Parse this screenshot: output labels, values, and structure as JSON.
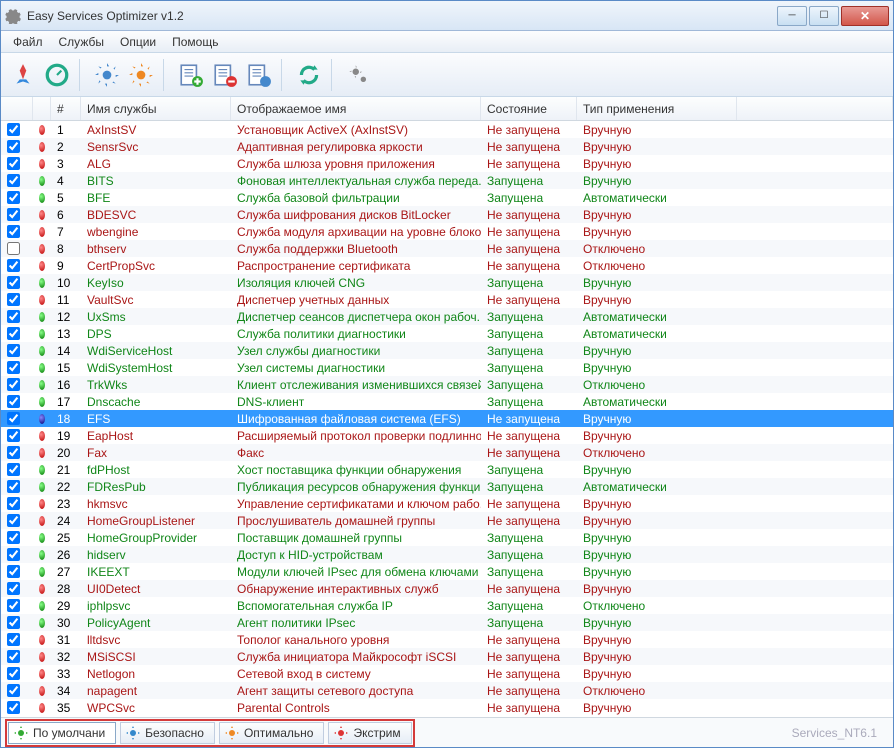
{
  "title": "Easy Services Optimizer v1.2",
  "menu": [
    "Файл",
    "Службы",
    "Опции",
    "Помощь"
  ],
  "columns": {
    "num": "#",
    "name": "Имя службы",
    "disp": "Отображаемое имя",
    "state": "Состояние",
    "type": "Тип применения"
  },
  "footer": {
    "tabs": [
      "По умолчани",
      "Безопасно",
      "Оптимально",
      "Экстрим"
    ],
    "status": "Services_NT6.1"
  },
  "rows": [
    {
      "n": 1,
      "chk": true,
      "dot": "red",
      "name": "AxInstSV",
      "disp": "Установщик ActiveX (AxInstSV)",
      "state": "Не запущена",
      "type": "Вручную",
      "c": "red"
    },
    {
      "n": 2,
      "chk": true,
      "dot": "red",
      "name": "SensrSvc",
      "disp": "Адаптивная регулировка яркости",
      "state": "Не запущена",
      "type": "Вручную",
      "c": "red"
    },
    {
      "n": 3,
      "chk": true,
      "dot": "red",
      "name": "ALG",
      "disp": "Служба шлюза уровня приложения",
      "state": "Не запущена",
      "type": "Вручную",
      "c": "red"
    },
    {
      "n": 4,
      "chk": true,
      "dot": "green",
      "name": "BITS",
      "disp": "Фоновая интеллектуальная служба переда...",
      "state": "Запущена",
      "type": "Вручную",
      "c": "green"
    },
    {
      "n": 5,
      "chk": true,
      "dot": "green",
      "name": "BFE",
      "disp": "Служба базовой фильтрации",
      "state": "Запущена",
      "type": "Автоматически",
      "c": "green"
    },
    {
      "n": 6,
      "chk": true,
      "dot": "red",
      "name": "BDESVC",
      "disp": "Служба шифрования дисков BitLocker",
      "state": "Не запущена",
      "type": "Вручную",
      "c": "red"
    },
    {
      "n": 7,
      "chk": true,
      "dot": "red",
      "name": "wbengine",
      "disp": "Служба модуля архивации на уровне блоков",
      "state": "Не запущена",
      "type": "Вручную",
      "c": "red"
    },
    {
      "n": 8,
      "chk": false,
      "dot": "red",
      "name": "bthserv",
      "disp": "Служба поддержки Bluetooth",
      "state": "Не запущена",
      "type": "Отключено",
      "c": "red"
    },
    {
      "n": 9,
      "chk": true,
      "dot": "red",
      "name": "CertPropSvc",
      "disp": "Распространение сертификата",
      "state": "Не запущена",
      "type": "Отключено",
      "c": "red"
    },
    {
      "n": 10,
      "chk": true,
      "dot": "green",
      "name": "KeyIso",
      "disp": "Изоляция ключей CNG",
      "state": "Запущена",
      "type": "Вручную",
      "c": "green"
    },
    {
      "n": 11,
      "chk": true,
      "dot": "red",
      "name": "VaultSvc",
      "disp": "Диспетчер учетных данных",
      "state": "Не запущена",
      "type": "Вручную",
      "c": "red"
    },
    {
      "n": 12,
      "chk": true,
      "dot": "green",
      "name": "UxSms",
      "disp": "Диспетчер сеансов диспетчера окон рабоч...",
      "state": "Запущена",
      "type": "Автоматически",
      "c": "green"
    },
    {
      "n": 13,
      "chk": true,
      "dot": "green",
      "name": "DPS",
      "disp": "Служба политики диагностики",
      "state": "Запущена",
      "type": "Автоматически",
      "c": "green"
    },
    {
      "n": 14,
      "chk": true,
      "dot": "green",
      "name": "WdiServiceHost",
      "disp": "Узел службы диагностики",
      "state": "Запущена",
      "type": "Вручную",
      "c": "green"
    },
    {
      "n": 15,
      "chk": true,
      "dot": "green",
      "name": "WdiSystemHost",
      "disp": "Узел системы диагностики",
      "state": "Запущена",
      "type": "Вручную",
      "c": "green"
    },
    {
      "n": 16,
      "chk": true,
      "dot": "green",
      "name": "TrkWks",
      "disp": "Клиент отслеживания изменившихся связей",
      "state": "Запущена",
      "type": "Отключено",
      "c": "green"
    },
    {
      "n": 17,
      "chk": true,
      "dot": "green",
      "name": "Dnscache",
      "disp": "DNS-клиент",
      "state": "Запущена",
      "type": "Автоматически",
      "c": "green"
    },
    {
      "n": 18,
      "chk": true,
      "dot": "blue",
      "name": "EFS",
      "disp": "Шифрованная файловая система (EFS)",
      "state": "Не запущена",
      "type": "Вручную",
      "c": "blue",
      "sel": true
    },
    {
      "n": 19,
      "chk": true,
      "dot": "red",
      "name": "EapHost",
      "disp": "Расширяемый протокол проверки подлинно...",
      "state": "Не запущена",
      "type": "Вручную",
      "c": "red"
    },
    {
      "n": 20,
      "chk": true,
      "dot": "red",
      "name": "Fax",
      "disp": "Факс",
      "state": "Не запущена",
      "type": "Отключено",
      "c": "red"
    },
    {
      "n": 21,
      "chk": true,
      "dot": "green",
      "name": "fdPHost",
      "disp": "Хост поставщика функции обнаружения",
      "state": "Запущена",
      "type": "Вручную",
      "c": "green"
    },
    {
      "n": 22,
      "chk": true,
      "dot": "green",
      "name": "FDResPub",
      "disp": "Публикация ресурсов обнаружения функции",
      "state": "Запущена",
      "type": "Автоматически",
      "c": "green"
    },
    {
      "n": 23,
      "chk": true,
      "dot": "red",
      "name": "hkmsvc",
      "disp": "Управление сертификатами и ключом рабо...",
      "state": "Не запущена",
      "type": "Вручную",
      "c": "red"
    },
    {
      "n": 24,
      "chk": true,
      "dot": "red",
      "name": "HomeGroupListener",
      "disp": "Прослушиватель домашней группы",
      "state": "Не запущена",
      "type": "Вручную",
      "c": "red"
    },
    {
      "n": 25,
      "chk": true,
      "dot": "green",
      "name": "HomeGroupProvider",
      "disp": "Поставщик домашней группы",
      "state": "Запущена",
      "type": "Вручную",
      "c": "green"
    },
    {
      "n": 26,
      "chk": true,
      "dot": "green",
      "name": "hidserv",
      "disp": "Доступ к HID-устройствам",
      "state": "Запущена",
      "type": "Вручную",
      "c": "green"
    },
    {
      "n": 27,
      "chk": true,
      "dot": "green",
      "name": "IKEEXT",
      "disp": "Модули ключей IPsec для обмена ключами ...",
      "state": "Запущена",
      "type": "Вручную",
      "c": "green"
    },
    {
      "n": 28,
      "chk": true,
      "dot": "red",
      "name": "UI0Detect",
      "disp": "Обнаружение интерактивных служб",
      "state": "Не запущена",
      "type": "Вручную",
      "c": "red"
    },
    {
      "n": 29,
      "chk": true,
      "dot": "green",
      "name": "iphlpsvc",
      "disp": "Вспомогательная служба IP",
      "state": "Запущена",
      "type": "Отключено",
      "c": "green"
    },
    {
      "n": 30,
      "chk": true,
      "dot": "green",
      "name": "PolicyAgent",
      "disp": "Агент политики IPsec",
      "state": "Запущена",
      "type": "Вручную",
      "c": "green"
    },
    {
      "n": 31,
      "chk": true,
      "dot": "red",
      "name": "lltdsvc",
      "disp": "Тополог канального уровня",
      "state": "Не запущена",
      "type": "Вручную",
      "c": "red"
    },
    {
      "n": 32,
      "chk": true,
      "dot": "red",
      "name": "MSiSCSI",
      "disp": "Служба инициатора Майкрософт iSCSI",
      "state": "Не запущена",
      "type": "Вручную",
      "c": "red"
    },
    {
      "n": 33,
      "chk": true,
      "dot": "red",
      "name": "Netlogon",
      "disp": "Сетевой вход в систему",
      "state": "Не запущена",
      "type": "Вручную",
      "c": "red"
    },
    {
      "n": 34,
      "chk": true,
      "dot": "red",
      "name": "napagent",
      "disp": "Агент защиты сетевого доступа",
      "state": "Не запущена",
      "type": "Отключено",
      "c": "red"
    },
    {
      "n": 35,
      "chk": true,
      "dot": "red",
      "name": "WPCSvc",
      "disp": "Parental Controls",
      "state": "Не запущена",
      "type": "Вручную",
      "c": "red"
    }
  ]
}
